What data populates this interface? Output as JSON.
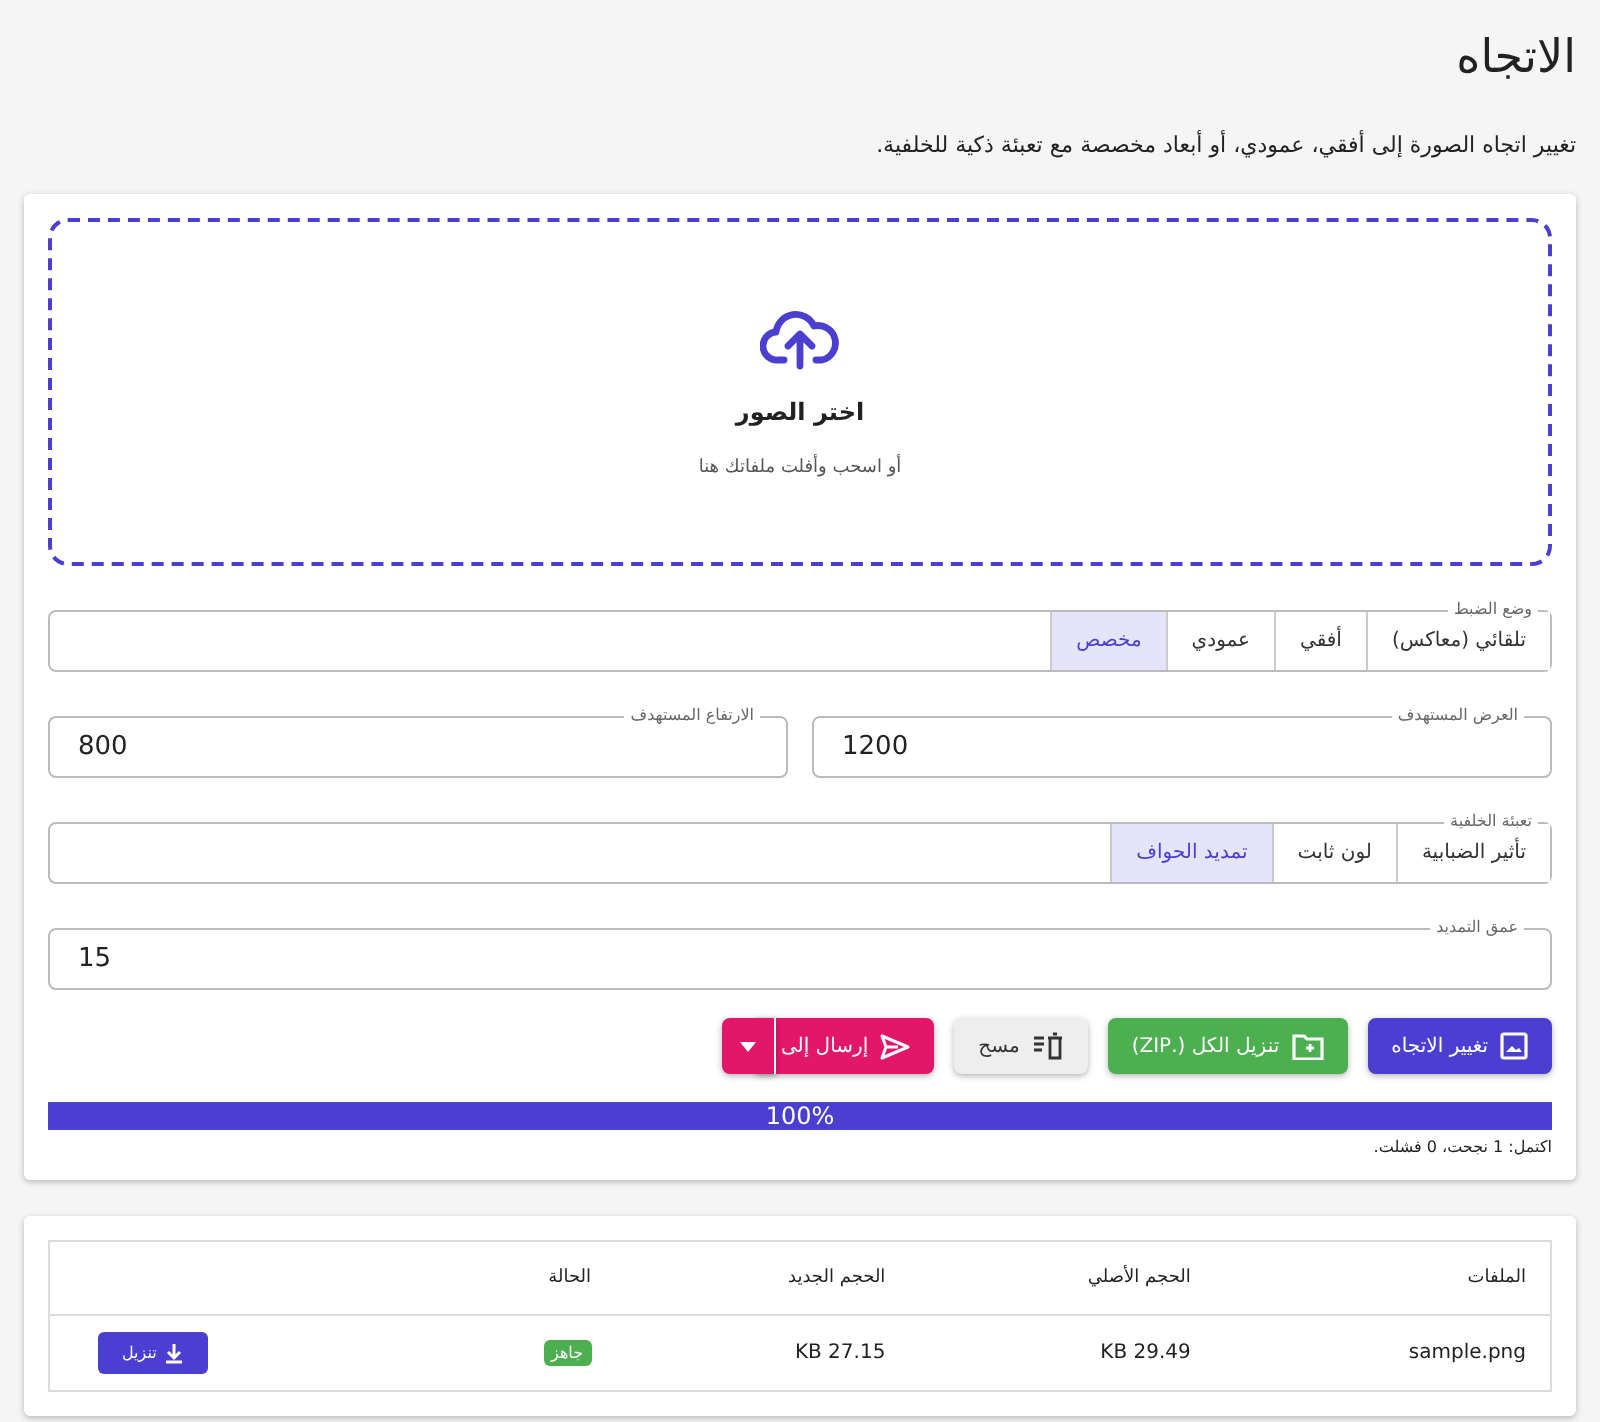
{
  "page": {
    "title": "الاتجاه",
    "description": "تغيير اتجاه الصورة إلى أفقي، عمودي، أو أبعاد مخصصة مع تعبئة ذكية للخلفية."
  },
  "dropzone": {
    "title": "اختر الصور",
    "hint": "أو اسحب وأفلت ملفاتك هنا"
  },
  "mode": {
    "label": "وضع الضبط",
    "options": [
      {
        "label": "تلقائي (معاكس)",
        "selected": false
      },
      {
        "label": "أفقي",
        "selected": false
      },
      {
        "label": "عمودي",
        "selected": false
      },
      {
        "label": "مخصص",
        "selected": true
      }
    ]
  },
  "size_fields": [
    {
      "label": "العرض المستهدف",
      "value": "1200"
    },
    {
      "label": "الارتفاع المستهدف",
      "value": "800"
    }
  ],
  "fill": {
    "label": "تعبئة الخلفية",
    "options": [
      {
        "label": "تأثير الضبابية",
        "selected": false
      },
      {
        "label": "لون ثابت",
        "selected": false
      },
      {
        "label": "تمديد الحواف",
        "selected": true
      }
    ]
  },
  "depth_field": {
    "label": "عمق التمديد",
    "value": "15"
  },
  "actions": [
    {
      "kind": "primary",
      "label": "تغيير الاتجاه"
    },
    {
      "kind": "success",
      "label": "تنزيل الكل (.ZIP)"
    },
    {
      "kind": "plain",
      "label": "مسح"
    },
    {
      "kind": "split",
      "label": "إرسال إلى"
    }
  ],
  "progress": {
    "level": 1,
    "reading": "100%",
    "summary": "اكتمل: 1 نجحت، 0 فشلت."
  },
  "table": {
    "columns": [
      "الملفات",
      "الحجم الأصلي",
      "الحجم الجديد",
      "الحالة"
    ],
    "rows": [
      {
        "name": "sample.png",
        "original": "29.49 KB",
        "new": "27.15 KB",
        "status": "جاهز",
        "action": "تنزيل"
      }
    ]
  }
}
